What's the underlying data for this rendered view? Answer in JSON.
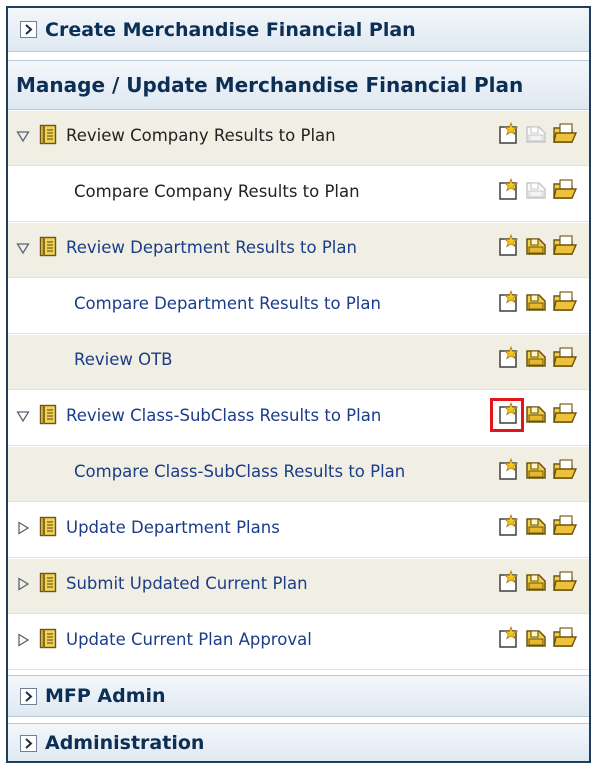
{
  "sections": {
    "create": "Create Merchandise Financial Plan",
    "manage": "Manage / Update Merchandise Financial Plan",
    "mfp_admin": "MFP Admin",
    "administration": "Administration"
  },
  "rows": [
    {
      "label": "Review Company Results to Plan",
      "type": "parent",
      "expanded": true,
      "link": false,
      "copy_enabled": false
    },
    {
      "label": "Compare Company Results to Plan",
      "type": "child",
      "link": false,
      "copy_enabled": false
    },
    {
      "label": "Review Department Results to Plan",
      "type": "parent",
      "expanded": true,
      "link": true,
      "copy_enabled": true
    },
    {
      "label": "Compare Department Results to Plan",
      "type": "child",
      "link": true,
      "copy_enabled": true
    },
    {
      "label": "Review OTB",
      "type": "child",
      "link": true,
      "copy_enabled": true
    },
    {
      "label": "Review Class-SubClass Results to Plan",
      "type": "parent",
      "expanded": true,
      "link": true,
      "copy_enabled": true,
      "highlighted_icon": "new-workbook-icon"
    },
    {
      "label": "Compare Class-SubClass Results to Plan",
      "type": "child",
      "link": true,
      "copy_enabled": true
    },
    {
      "label": "Update Department Plans",
      "type": "parent",
      "expanded": false,
      "link": true,
      "copy_enabled": true
    },
    {
      "label": "Submit Updated Current Plan",
      "type": "parent",
      "expanded": false,
      "link": true,
      "copy_enabled": true
    },
    {
      "label": "Update Current Plan Approval",
      "type": "parent",
      "expanded": false,
      "link": true,
      "copy_enabled": true
    }
  ],
  "colors": {
    "header_text": "#0b2f55",
    "link_text": "#1a3c8a",
    "highlight": "#e3151a",
    "alt_row": "#f1efe4"
  }
}
